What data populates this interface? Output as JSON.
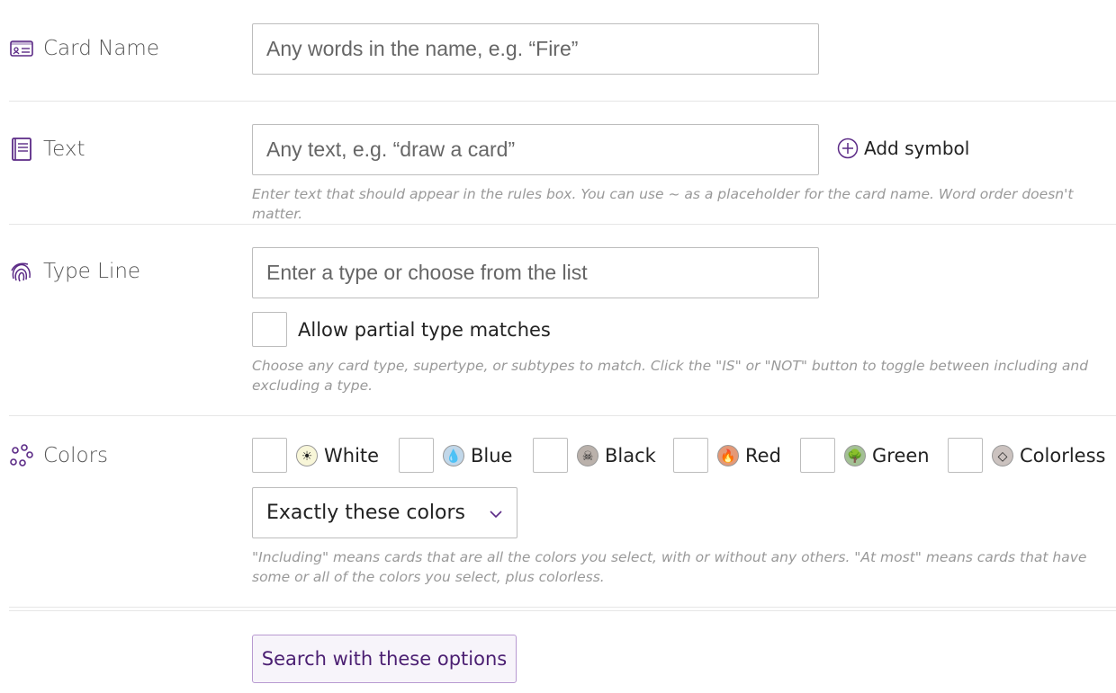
{
  "card_name": {
    "label": "Card Name",
    "placeholder": "Any words in the name, e.g. “Fire”",
    "value": ""
  },
  "text": {
    "label": "Text",
    "placeholder": "Any text, e.g. “draw a card”",
    "value": "",
    "add_symbol_label": "Add symbol",
    "hint": "Enter text that should appear in the rules box. You can use ~ as a placeholder for the card name. Word order doesn't matter."
  },
  "type_line": {
    "label": "Type Line",
    "placeholder": "Enter a type or choose from the list",
    "value": "",
    "partial_label": "Allow partial type matches",
    "hint": "Choose any card type, supertype, or subtypes to match. Click the \"IS\" or \"NOT\" button to toggle between including and excluding a type."
  },
  "colors": {
    "label": "Colors",
    "options": [
      {
        "label": "White",
        "icon": "white-mana-icon",
        "glyph": "☀",
        "color": "#f8f6d8"
      },
      {
        "label": "Blue",
        "icon": "blue-mana-icon",
        "glyph": "💧",
        "color": "#c1d7e9"
      },
      {
        "label": "Black",
        "icon": "black-mana-icon",
        "glyph": "☠",
        "color": "#bab1ab"
      },
      {
        "label": "Red",
        "icon": "red-mana-icon",
        "glyph": "🔥",
        "color": "#e49977"
      },
      {
        "label": "Green",
        "icon": "green-mana-icon",
        "glyph": "🌳",
        "color": "#a3c095"
      },
      {
        "label": "Colorless",
        "icon": "colorless-mana-icon",
        "glyph": "◇",
        "color": "#cbc2bf"
      }
    ],
    "mode_selected": "Exactly these colors",
    "hint": "\"Including\" means cards that are all the colors you select, with or without any others. \"At most\" means cards that have some or all of the colors you select, plus colorless."
  },
  "submit_label": "Search with these options",
  "accent_color": "#5b2a86"
}
